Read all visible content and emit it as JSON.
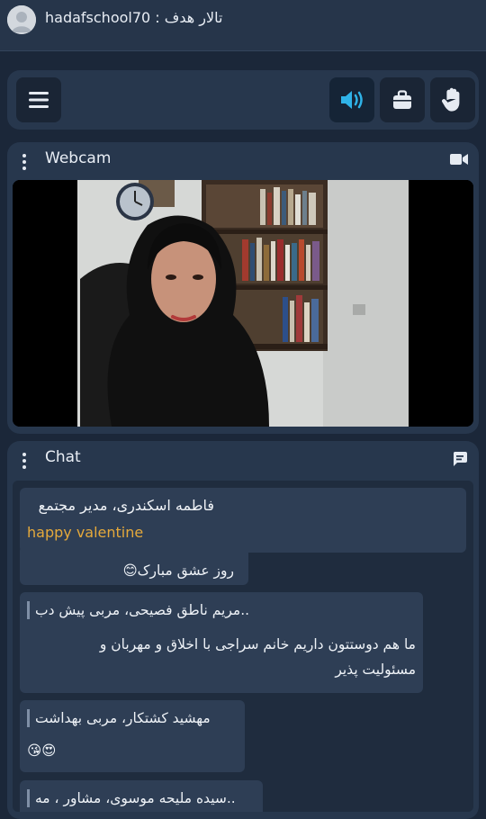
{
  "topbar": {
    "title": "hadafschool70 : تالار هدف"
  },
  "toolbar": {
    "menu_icon": "hamburger-icon",
    "right_icons": [
      "speaker-icon",
      "briefcase-icon",
      "raise-hand-icon"
    ],
    "accent": "#2fb3e8"
  },
  "webcam": {
    "title": "Webcam",
    "icon": "video-camera-icon"
  },
  "chat": {
    "title": "Chat",
    "icon": "chat-bubble-icon",
    "pinned": {
      "sender": "فاطمه اسکندری، مدیر مجتمع",
      "text": "happy valentine"
    },
    "messages": [
      {
        "sender": "",
        "text": "روز عشق مبارک😊"
      },
      {
        "sender": "..مریم ناطق فصیحی، مربی پیش دب",
        "text": "ما هم دوستتون داریم خانم سراجی با اخلاق و مهربان و مسئولیت پذیر"
      },
      {
        "sender": "مهشید کشتکار، مربی بهداشت",
        "text": "😍😘"
      },
      {
        "sender": "..سیده ملیحه موسوی، مشاور ، مه",
        "text": ""
      }
    ]
  }
}
